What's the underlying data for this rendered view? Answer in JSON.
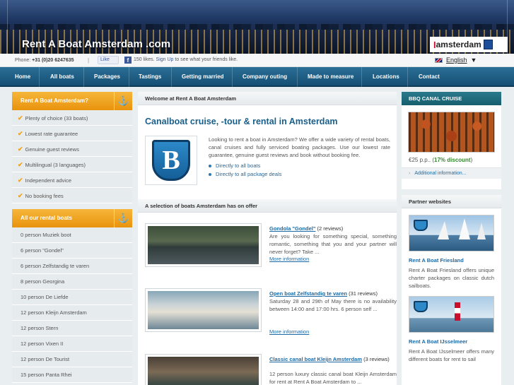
{
  "header": {
    "site_title": "Rent A Boat Amsterdam .com",
    "logo_i": "I",
    "logo_text": "amsterdam"
  },
  "infobar": {
    "phone_label": "Phone:",
    "phone_number": "+31 (0)20 6247635",
    "separator": "|",
    "like_button": "Like",
    "fb_icon": "f",
    "likes_text": "150 likes.",
    "signup_link": "Sign Up",
    "signup_suffix": "to see what your friends like.",
    "language": "English",
    "language_arrow": "▼"
  },
  "nav": {
    "items": [
      "Home",
      "All boats",
      "Packages",
      "Tastings",
      "Getting married",
      "Company outing",
      "Made to measure",
      "Locations",
      "Contact"
    ]
  },
  "sidebar": {
    "why_title": "Rent A Boat Amsterdam?",
    "anchor_icon": "⚓",
    "why_items": [
      "Plenty of choice (33 boats)",
      "Lowest rate guarantee",
      "Genuine guest reviews",
      "Multilingual (3 languages)",
      "Independent advice",
      "No booking fees"
    ],
    "tick_icon": "✔",
    "boats_title": "All our rental boats",
    "boats": [
      "0 person Muziek boot",
      "6 person \"Gondel\"",
      "6 person Zelfstandig te varen",
      "8 person Georgina",
      "10 person De Liefde",
      "12 person Kleijn Amsterdam",
      "12 person Stern",
      "12 person Vixen II",
      "12 person De Tourist",
      "15 person Panta Rhei"
    ]
  },
  "main": {
    "welcome_head": "Welcome at Rent A Boat Amsterdam",
    "title": "Canalboat cruise, -tour & rental in Amsterdam",
    "logo_letter": "B",
    "intro": "Looking to rent a boat in Amsterdam? We offer a wide variety of rental boats, canal cruises and fully serviced boating packages. Use our lowest rate guarantee, genuine guest reviews and book without booking fee.",
    "link_all_boats": "Directly to all boats",
    "link_packages": "Directly to all package deals",
    "offer_head": "A selection of boats Amsterdam has on offer",
    "boats": [
      {
        "name": "Gondola \"Gondel\"",
        "reviews": "(2 reviews)",
        "desc": "Are you looking for something special, something romantic, something that you and your partner will never forget? Take ...",
        "more": "More information"
      },
      {
        "name": "Open boat Zelfstandig te varen",
        "reviews": "(31 reviews)",
        "desc": "Saturday 28 and 29th of May there is no availability between 14:00 and 17:00 hrs. 6 person self ...",
        "more": "More information"
      },
      {
        "name": "Classic canal boat Kleijn Amsterdam",
        "reviews": "(3 reviews)",
        "desc": "12 person luxury classic canal boat Kleijn Amsterdam for rent at Rent A Boat Amsterdam to ...",
        "more": ""
      }
    ]
  },
  "right": {
    "bbq_head": "BBQ CANAL CRUISE",
    "price_text": "€25 p.p.. (",
    "discount": "17% discount",
    "price_close": ")",
    "addl_arrow": "›",
    "addl_link": "Additional information...",
    "partners_head": "Partner websites",
    "partners": [
      {
        "title": "Rent A Boat Friesland",
        "desc": "Rent A Boat Friesland offers unique charter packages on classic dutch sailboats."
      },
      {
        "title": "Rent A Boat IJsselmeer",
        "desc": "Rent A Boat IJsselmeer offers many different boats for rent to sail"
      }
    ]
  }
}
